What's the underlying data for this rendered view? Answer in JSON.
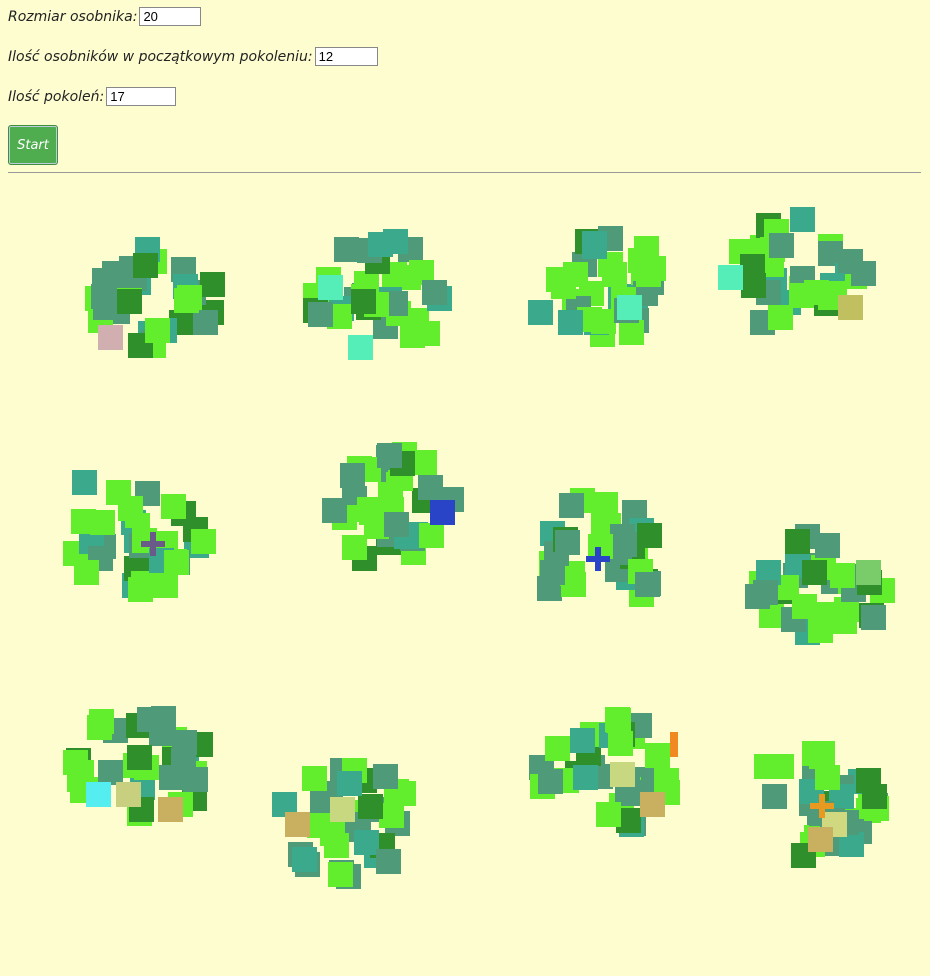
{
  "form": {
    "size_label": "Rozmiar osobnika:",
    "size_value": "20",
    "count_label": "Ilość osobników w początkowym pokoleniu:",
    "count_value": "12",
    "generations_label": "Ilość pokoleń:",
    "generations_value": "17",
    "start_label": "Start"
  },
  "palette": {
    "background": "#fefdd0",
    "bright_green": "#62ee2c",
    "teal": "#4f9a78",
    "dark_green": "#2f8f2a",
    "sea_green": "#3aa98c"
  }
}
